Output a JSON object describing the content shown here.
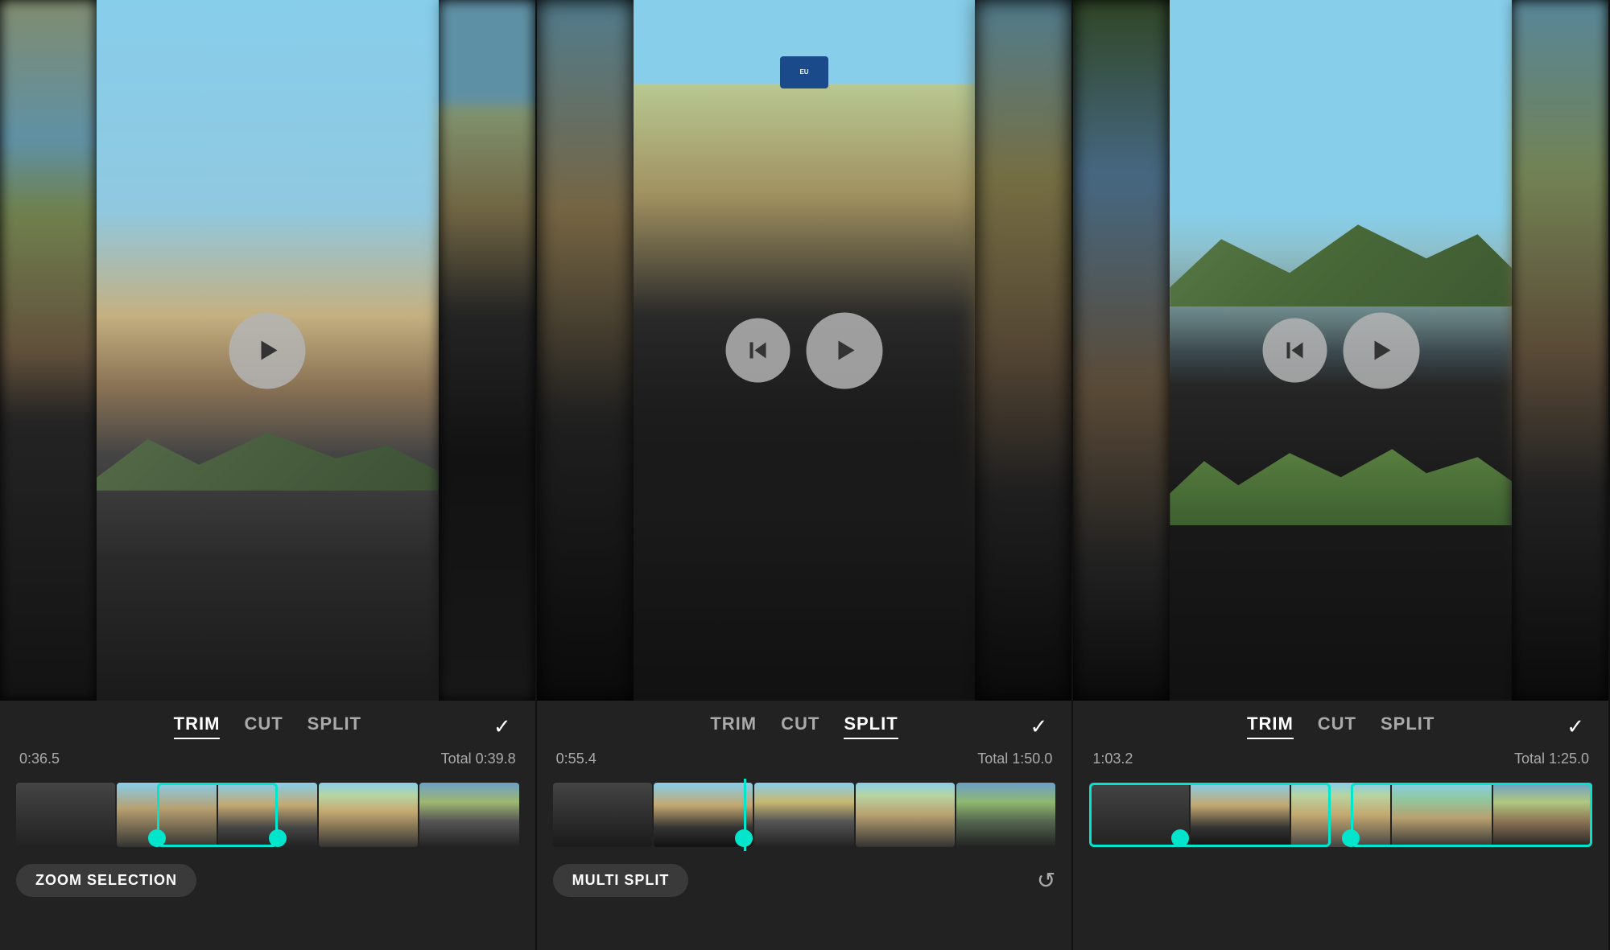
{
  "panels": [
    {
      "id": "panel-1",
      "tabs": [
        {
          "label": "TRIM",
          "active": true
        },
        {
          "label": "CUT",
          "active": false
        },
        {
          "label": "SPLIT",
          "active": false
        }
      ],
      "check": "✓",
      "time_current": "0:36.5",
      "time_total": "Total 0:39.8",
      "controls": [
        "play"
      ],
      "bottom_btn": "ZOOM SELECTION",
      "active_tab": "TRIM",
      "mode": "trim"
    },
    {
      "id": "panel-2",
      "tabs": [
        {
          "label": "TRIM",
          "active": false
        },
        {
          "label": "CUT",
          "active": false
        },
        {
          "label": "SPLIT",
          "active": true
        }
      ],
      "check": "✓",
      "time_current": "0:55.4",
      "time_total": "Total 1:50.0",
      "controls": [
        "skip-back",
        "play"
      ],
      "bottom_btn": "MULTI SPLIT",
      "active_tab": "SPLIT",
      "mode": "split"
    },
    {
      "id": "panel-3",
      "tabs": [
        {
          "label": "TRIM",
          "active": true
        },
        {
          "label": "CUT",
          "active": false
        },
        {
          "label": "SPLIT",
          "active": false
        }
      ],
      "check": "✓",
      "time_current": "1:03.2",
      "time_total": "Total 1:25.0",
      "controls": [
        "skip-back",
        "play"
      ],
      "bottom_btn": null,
      "active_tab": "TRIM",
      "mode": "trim2"
    }
  ],
  "icons": {
    "play": "▶",
    "skip_back": "⏮",
    "check": "✓",
    "reset": "↺"
  }
}
